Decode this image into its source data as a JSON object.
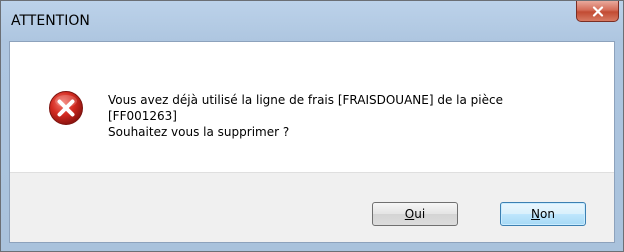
{
  "window": {
    "title": "ATTENTION"
  },
  "icon": "error-icon",
  "message": {
    "line1": "Vous avez déjà utilisé la ligne de frais [FRAISDOUANE] de la pièce",
    "line2": "[FF001263]",
    "line3": "Souhaitez vous la supprimer ?"
  },
  "buttons": {
    "yes_mnemonic": "O",
    "yes_rest": "ui",
    "no_mnemonic": "N",
    "no_rest": "on"
  },
  "colors": {
    "error_red": "#d81e1e",
    "close_red": "#c24b33",
    "default_button_border": "#3c7fb1"
  }
}
